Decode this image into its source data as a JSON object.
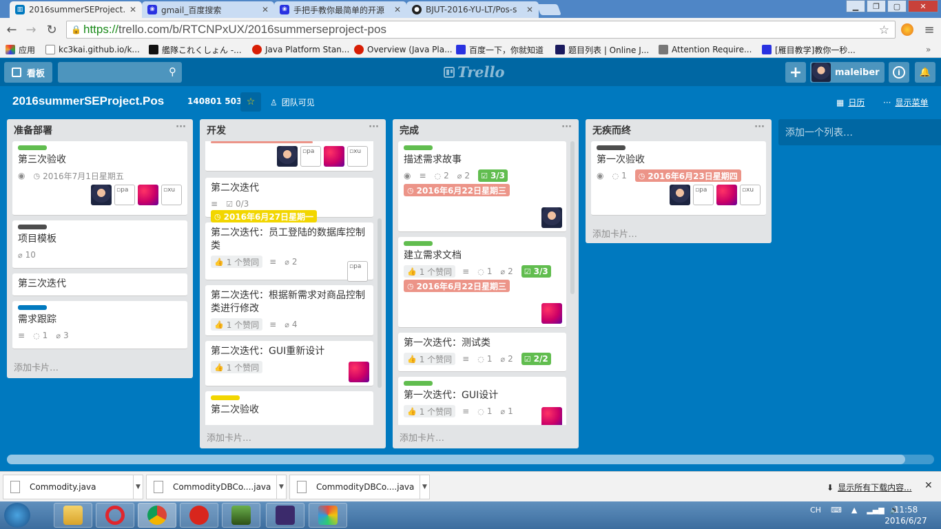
{
  "browser": {
    "tabs": [
      {
        "label": "2016summerSEProject.P",
        "active": true,
        "icon": "trello-icon"
      },
      {
        "label": "gmail_百度搜索",
        "icon": "baidu-icon"
      },
      {
        "label": "手把手教你最简单的开源",
        "icon": "baidu-icon"
      },
      {
        "label": "BJUT-2016-YU-LT/Pos-s",
        "icon": "github-icon"
      }
    ],
    "url_scheme": "https://",
    "url_rest": "trello.com/b/RTCNPxUX/2016summerseproject-pos",
    "bookmarks": [
      {
        "label": "应用"
      },
      {
        "label": "kc3kai.github.io/k..."
      },
      {
        "label": "艦隊これくしょん -..."
      },
      {
        "label": "Java Platform Stan..."
      },
      {
        "label": "Overview (Java Pla..."
      },
      {
        "label": "百度一下，你就知道"
      },
      {
        "label": "题目列表 | Online J..."
      },
      {
        "label": "Attention Require..."
      },
      {
        "label": "[雁目教学]教你一秒..."
      }
    ]
  },
  "trello": {
    "boards_label": "看板",
    "logo": "Trello",
    "username": "maleiber",
    "add_label": "+",
    "info_label": "i",
    "board_title": "2016summerSEProject.Pos",
    "board_id": "140801 503",
    "visibility": "团队可见",
    "calendar": "日历",
    "show_menu": "显示菜单",
    "add_list": "添加一个列表…",
    "add_card": "添加卡片…"
  },
  "lists": [
    {
      "title": "准备部署",
      "cards": [
        {
          "label_color": "#61bd4f",
          "title": "第三次验收",
          "watch": true,
          "date_plain": "2016年7月1日星期五",
          "members": [
            "photo",
            "broken:pa",
            "pink",
            "broken:xu"
          ]
        },
        {
          "label_color": "#4d4d4d",
          "title": "项目模板",
          "attachments": "10"
        },
        {
          "title": "第三次迭代"
        },
        {
          "label_color": "#0079bf",
          "title": "需求跟踪",
          "desc": true,
          "comments": "1",
          "attachments": "3"
        }
      ]
    },
    {
      "title": "开发",
      "cards": [
        {
          "title": "",
          "members": [
            "photo",
            "broken:pa",
            "pink",
            "broken:xu"
          ]
        },
        {
          "title": "第二次迭代",
          "desc": true,
          "checklist": "0/3",
          "due_yellow": "2016年6月27日星期一"
        },
        {
          "title": "第二次迭代：员工登陆的数据库控制类",
          "votes": "1 个赞同",
          "desc": true,
          "attachments": "2",
          "members": [
            "broken:pa"
          ]
        },
        {
          "title": "第二次迭代：根据新需求对商品控制类进行修改",
          "votes": "1 个赞同",
          "desc": true,
          "attachments": "4"
        },
        {
          "title": "第二次迭代：GUI重新设计",
          "votes": "1 个赞同",
          "members": [
            "pink"
          ]
        },
        {
          "label_color": "#f2d600",
          "title": "第二次验收"
        }
      ]
    },
    {
      "title": "完成",
      "cards": [
        {
          "label_color": "#61bd4f",
          "title": "描述需求故事",
          "watch": true,
          "desc": true,
          "comments": "2",
          "attachments": "2",
          "check_done": "3/3",
          "due_red": "2016年6月22日星期三",
          "members": [
            "photo"
          ]
        },
        {
          "label_color": "#61bd4f",
          "title": "建立需求文档",
          "votes": "1 个赞同",
          "desc": true,
          "comments": "1",
          "attachments": "2",
          "check_done": "3/3",
          "due_red": "2016年6月22日星期三",
          "members": [
            "pink"
          ]
        },
        {
          "title": "第一次迭代：测试类",
          "votes": "1 个赞同",
          "desc": true,
          "comments": "1",
          "attachments": "2",
          "check_done": "2/2"
        },
        {
          "label_color": "#61bd4f",
          "title": "第一次迭代：GUI设计",
          "votes": "1 个赞同",
          "desc": true,
          "comments": "1",
          "attachments": "1",
          "members": [
            "pink"
          ]
        }
      ]
    },
    {
      "title": "无疾而终",
      "cards": [
        {
          "label_color": "#4d4d4d",
          "title": "第一次验收",
          "watch": true,
          "comments": "1",
          "due_red": "2016年6月23日星期四",
          "members": [
            "photo",
            "broken:pa",
            "pink",
            "broken:xu"
          ]
        }
      ]
    }
  ],
  "downloads": {
    "items": [
      "Commodity.java",
      "CommodityDBCo....java",
      "CommodityDBCo....java"
    ],
    "show_all": "显示所有下载内容..."
  },
  "taskbar": {
    "ime": "CH",
    "time": "11:58",
    "date": "2016/6/27"
  }
}
